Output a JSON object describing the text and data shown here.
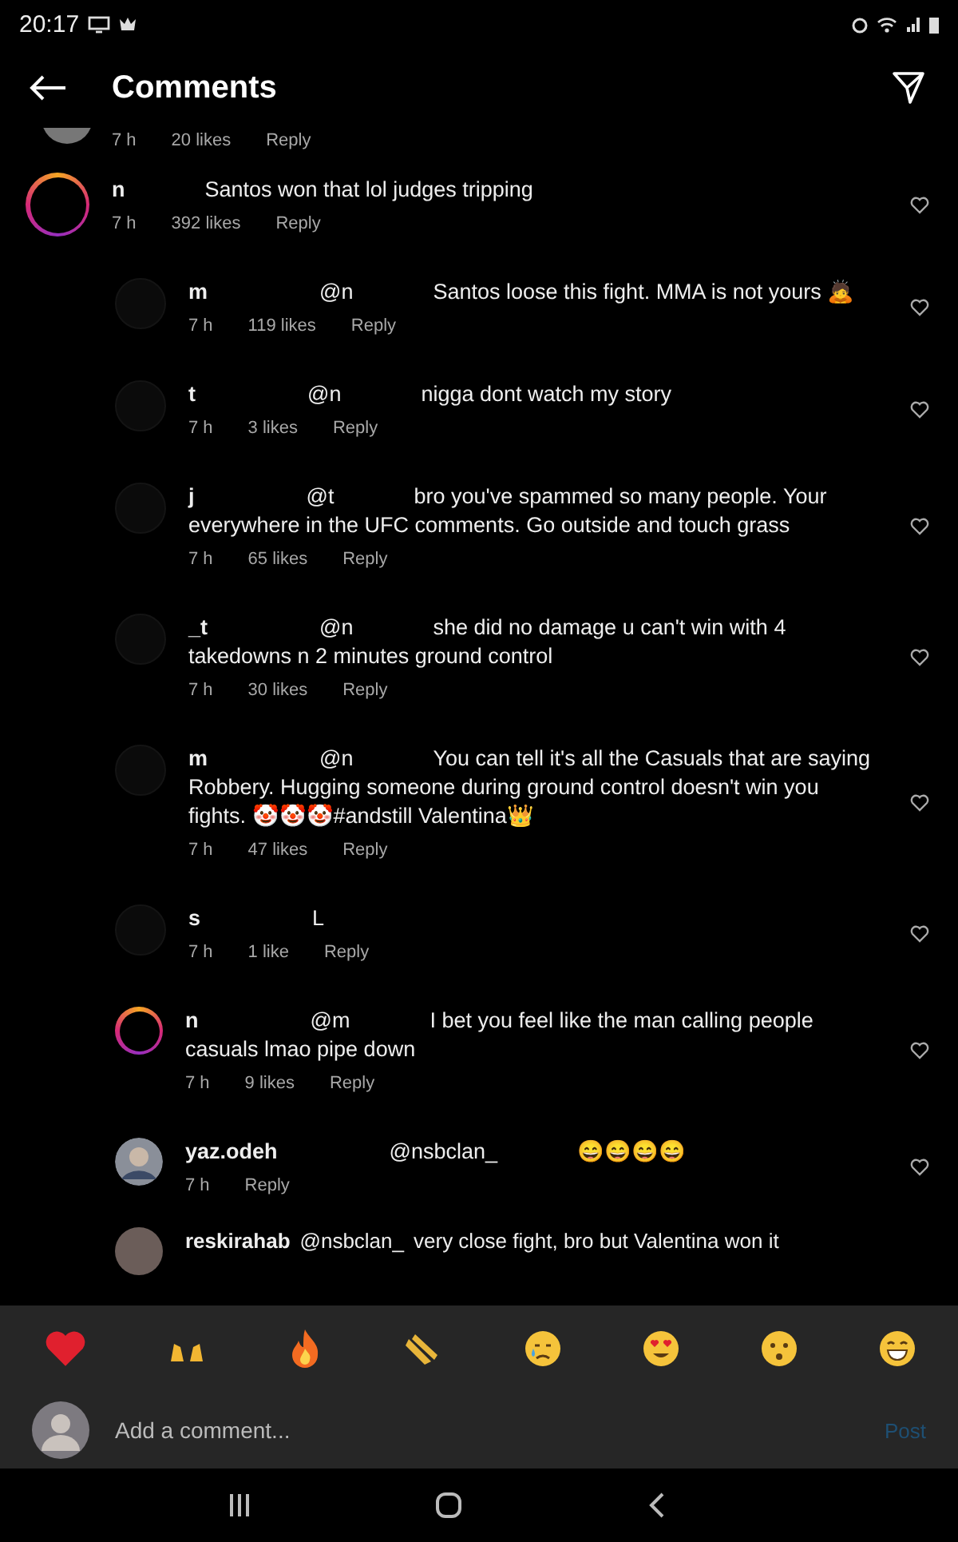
{
  "status_bar": {
    "time": "20:17"
  },
  "header": {
    "title": "Comments"
  },
  "partial_top": {
    "time": "7 h",
    "likes": "20 likes",
    "reply": "Reply"
  },
  "comments": [
    {
      "kind": "ring",
      "reply": false,
      "username": "n",
      "text": "Santos won that lol judges tripping",
      "time": "7 h",
      "likes": "392 likes",
      "action": "Reply"
    },
    {
      "kind": "plain",
      "reply": true,
      "username": "m",
      "mention": "@n",
      "text": "Santos loose this fight. MMA is not yours 🙇",
      "time": "7 h",
      "likes": "119 likes",
      "action": "Reply"
    },
    {
      "kind": "plain",
      "reply": true,
      "username": "t",
      "mention": "@n",
      "text": "nigga dont watch my story",
      "time": "7 h",
      "likes": "3 likes",
      "action": "Reply"
    },
    {
      "kind": "plain",
      "reply": true,
      "username": "j",
      "mention": "@t",
      "text": "bro you've spammed so many people. Your everywhere in the UFC comments. Go outside and touch grass",
      "time": "7 h",
      "likes": "65 likes",
      "action": "Reply"
    },
    {
      "kind": "plain",
      "reply": true,
      "username": "_t",
      "mention": "@n",
      "text": "she did no damage u can't win with 4 takedowns n 2 minutes ground control",
      "time": "7 h",
      "likes": "30 likes",
      "action": "Reply"
    },
    {
      "kind": "plain",
      "reply": true,
      "username": "m",
      "mention": "@n",
      "text": "You can tell it's all the Casuals that are saying Robbery. Hugging someone during ground control doesn't win you fights. 🤡🤡🤡#andstill Valentina👑",
      "time": "7 h",
      "likes": "47 likes",
      "action": "Reply"
    },
    {
      "kind": "plain",
      "reply": true,
      "username": "s",
      "text": "L",
      "time": "7 h",
      "likes": "1 like",
      "action": "Reply"
    },
    {
      "kind": "ring",
      "reply": true,
      "username": "n",
      "mention": "@m",
      "text": "I bet you feel like the man calling people casuals lmao pipe down",
      "time": "7 h",
      "likes": "9 likes",
      "action": "Reply"
    },
    {
      "kind": "photo",
      "reply": true,
      "username": "yaz.odeh",
      "mention": "@nsbclan_",
      "text": "😄😄😄😄",
      "time": "7 h",
      "action": "Reply"
    }
  ],
  "partial_bottom": {
    "username": "reskirahab",
    "mention": "@nsbclan_",
    "text": "very close fight, bro but Valentina won it"
  },
  "composer": {
    "placeholder": "Add a comment...",
    "post": "Post"
  }
}
